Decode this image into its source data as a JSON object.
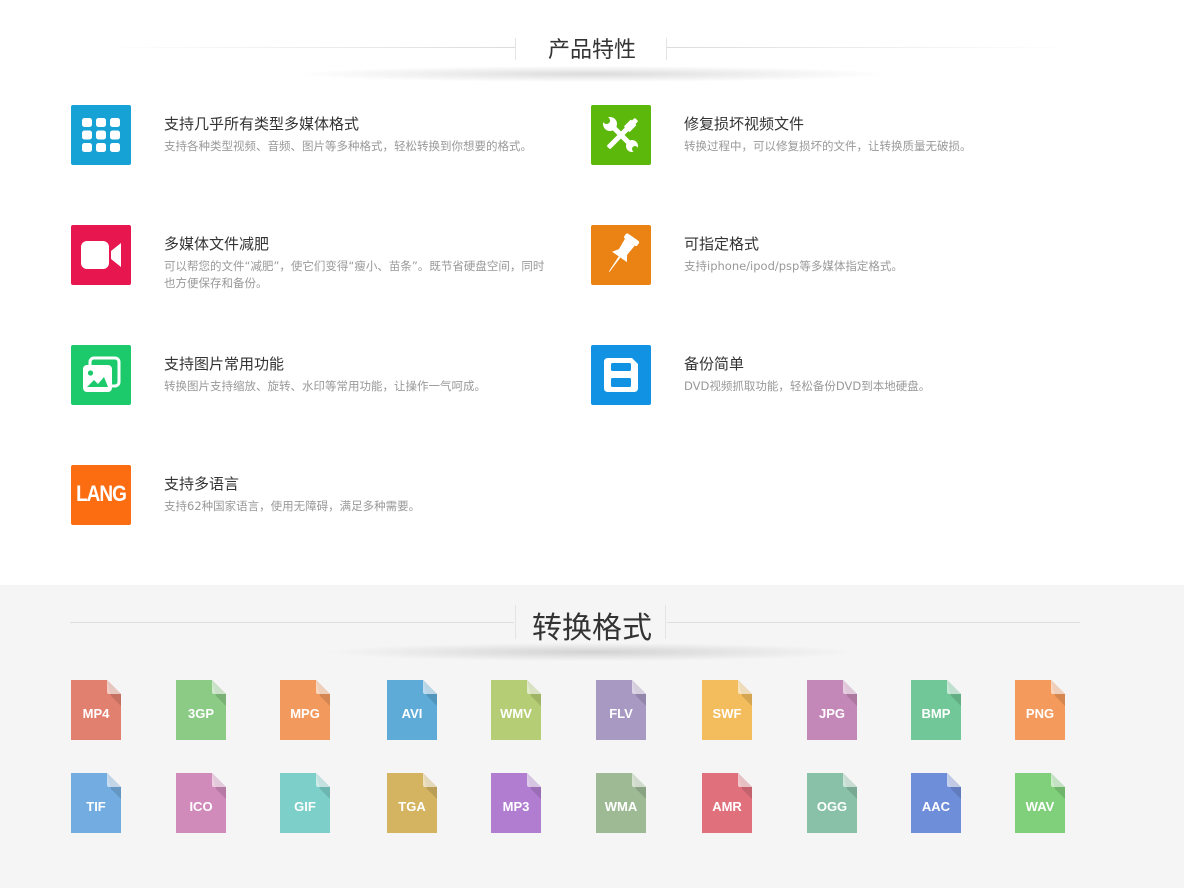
{
  "features_section": {
    "title": "产品特性",
    "items": [
      {
        "title": "支持几乎所有类型多媒体格式",
        "desc": "支持各种类型视频、音频、图片等多种格式，轻松转换到你想要的格式。",
        "icon": "grid-apps-icon",
        "color": "#17a2d6"
      },
      {
        "title": "修复损坏视频文件",
        "desc": "转换过程中，可以修复损坏的文件，让转换质量无破损。",
        "icon": "repair-tools-icon",
        "color": "#5cb80a"
      },
      {
        "title": "多媒体文件减肥",
        "desc": "可以帮您的文件“减肥”，使它们变得“瘦小、苗条”。既节省硬盘空间，同时也方便保存和备份。",
        "icon": "video-camera-icon",
        "color": "#e8164f"
      },
      {
        "title": "可指定格式",
        "desc": "支持iphone/ipod/psp等多媒体指定格式。",
        "icon": "pushpin-icon",
        "color": "#ea8313"
      },
      {
        "title": "支持图片常用功能",
        "desc": "转换图片支持缩放、旋转、水印等常用功能，让操作一气呵成。",
        "icon": "image-gallery-icon",
        "color": "#1cca6c"
      },
      {
        "title": "备份简单",
        "desc": "DVD视频抓取功能，轻松备份DVD到本地硬盘。",
        "icon": "save-disk-icon",
        "color": "#1192e2"
      },
      {
        "title": "支持多语言",
        "desc": "支持62种国家语言，使用无障碍，满足多种需要。",
        "icon": "language-icon",
        "icon_text": "LANG",
        "color": "#fc6c10"
      }
    ]
  },
  "formats_section": {
    "title": "转换格式",
    "items": [
      {
        "label": "MP4",
        "color": "#e2806f"
      },
      {
        "label": "3GP",
        "color": "#8bcb86"
      },
      {
        "label": "MPG",
        "color": "#f29a5e"
      },
      {
        "label": "AVI",
        "color": "#5fabd8"
      },
      {
        "label": "WMV",
        "color": "#b5cd74"
      },
      {
        "label": "FLV",
        "color": "#a899c3"
      },
      {
        "label": "SWF",
        "color": "#f3bc5c"
      },
      {
        "label": "JPG",
        "color": "#c488b8"
      },
      {
        "label": "BMP",
        "color": "#71c797"
      },
      {
        "label": "PNG",
        "color": "#f49a5c"
      },
      {
        "label": "TIF",
        "color": "#72ace0"
      },
      {
        "label": "ICO",
        "color": "#d18bbb"
      },
      {
        "label": "GIF",
        "color": "#7dcfc9"
      },
      {
        "label": "TGA",
        "color": "#d5b461"
      },
      {
        "label": "MP3",
        "color": "#b07dd0"
      },
      {
        "label": "WMA",
        "color": "#9dba95"
      },
      {
        "label": "AMR",
        "color": "#df707c"
      },
      {
        "label": "OGG",
        "color": "#88c1a8"
      },
      {
        "label": "AAC",
        "color": "#6f8ed9"
      },
      {
        "label": "WAV",
        "color": "#7fcf7b"
      }
    ]
  }
}
